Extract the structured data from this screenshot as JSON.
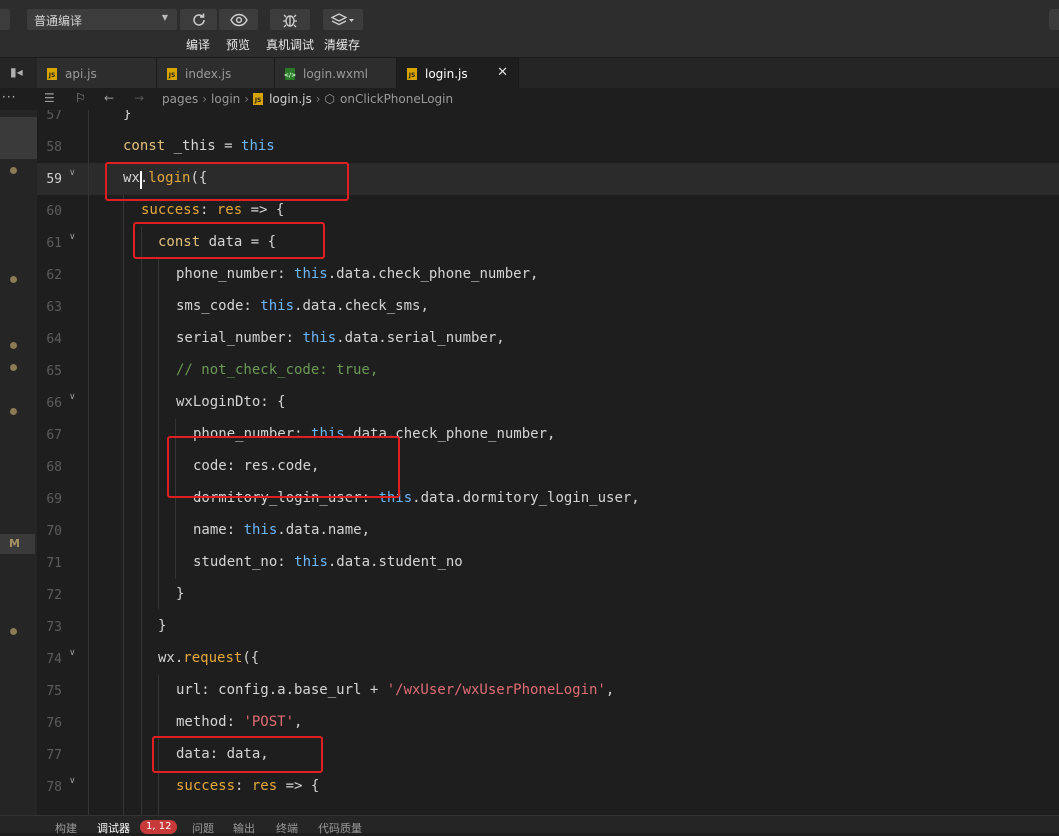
{
  "toolbar": {
    "compile_mode": "普通编译",
    "buttons": [
      {
        "label": "编译",
        "icon": "refresh-icon"
      },
      {
        "label": "预览",
        "icon": "eye-icon"
      },
      {
        "label": "真机调试",
        "icon": "bug-icon"
      },
      {
        "label": "清缓存",
        "icon": "layers-icon"
      }
    ]
  },
  "tabs": [
    {
      "name": "api.js",
      "type": "js",
      "active": false
    },
    {
      "name": "index.js",
      "type": "js",
      "active": false
    },
    {
      "name": "login.wxml",
      "type": "wxml",
      "active": false
    },
    {
      "name": "login.js",
      "type": "js",
      "active": true
    }
  ],
  "breadcrumb": {
    "dir1": "pages",
    "dir2": "login",
    "file": "login.js",
    "symbol": "onClickPhoneLogin"
  },
  "editor": {
    "current_line": "59",
    "lines": [
      {
        "num": "57",
        "text": "}"
      },
      {
        "num": "58",
        "text": "const _this = this"
      },
      {
        "num": "59",
        "text": "wx.login({"
      },
      {
        "num": "60",
        "text": "success: res => {"
      },
      {
        "num": "61",
        "text": "const data = {"
      },
      {
        "num": "62",
        "text": "phone_number: this.data.check_phone_number,"
      },
      {
        "num": "63",
        "text": "sms_code: this.data.check_sms,"
      },
      {
        "num": "64",
        "text": "serial_number: this.data.serial_number,"
      },
      {
        "num": "65",
        "text": "// not_check_code: true,"
      },
      {
        "num": "66",
        "text": "wxLoginDto: {"
      },
      {
        "num": "67",
        "text": "phone_number: this.data.check_phone_number,"
      },
      {
        "num": "68",
        "text": "code: res.code,"
      },
      {
        "num": "69",
        "text": "dormitory_login_user: this.data.dormitory_login_user,"
      },
      {
        "num": "70",
        "text": "name: this.data.name,"
      },
      {
        "num": "71",
        "text": "student_no: this.data.student_no"
      },
      {
        "num": "72",
        "text": "}"
      },
      {
        "num": "73",
        "text": "}"
      },
      {
        "num": "74",
        "text": "wx.request({"
      },
      {
        "num": "75",
        "text": "url: config.a.base_url + '/wxUser/wxUserPhoneLogin',"
      },
      {
        "num": "76",
        "text": "method: 'POST',"
      },
      {
        "num": "77",
        "text": "data: data,"
      },
      {
        "num": "78",
        "text": "success: res => {"
      }
    ]
  },
  "left_strip": {
    "badge": "M"
  },
  "bottom_tabs": [
    "构建",
    "调试器",
    "问题",
    "输出",
    "终端",
    "代码质量"
  ],
  "debugger_badge": "1, 12",
  "colors": {
    "keyword": "#e5c07b",
    "this": "#6cb6ff",
    "string": "#e06c75",
    "comment": "#6a9955",
    "annotation_box": "#e02020"
  }
}
